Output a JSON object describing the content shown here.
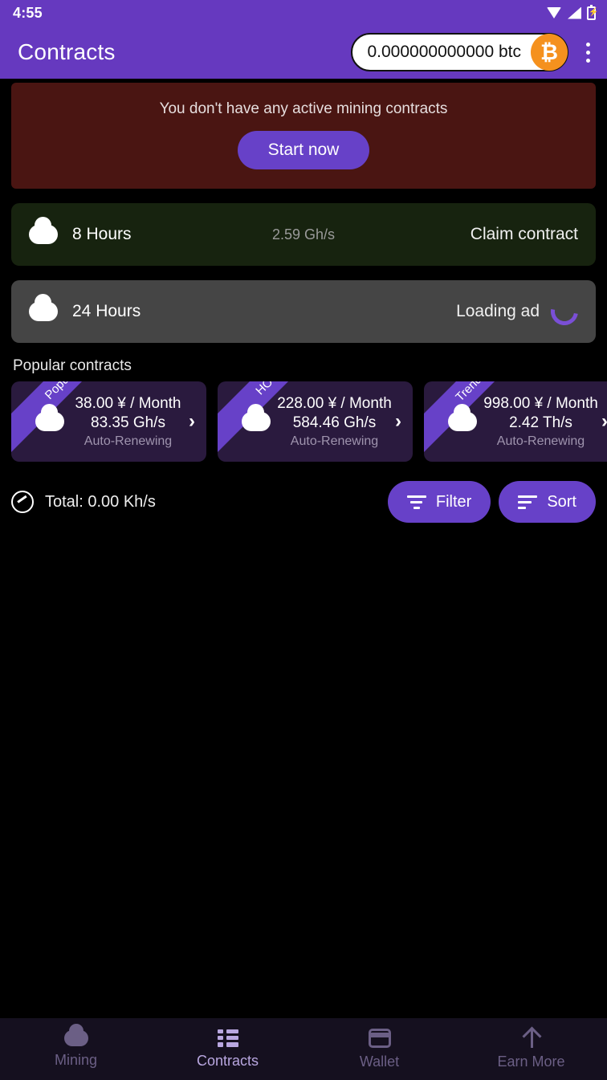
{
  "status_bar": {
    "time": "4:55",
    "icons": [
      "wifi-icon",
      "signal-icon",
      "battery-charging-icon"
    ]
  },
  "app_bar": {
    "title": "Contracts",
    "balance": "0.000000000000 btc",
    "currency_symbol": "₿",
    "overflow_label": "more-options",
    "accent_color": "#6639bf",
    "btc_color": "#f5911e"
  },
  "banner": {
    "message": "You don't have any active mining contracts",
    "cta_label": "Start now",
    "background_color": "#4a1512"
  },
  "claim_rows": [
    {
      "duration": "8 Hours",
      "rate": "2.59 Gh/s",
      "action": "Claim contract",
      "state": "ready",
      "background_color": "#17230f"
    },
    {
      "duration": "24 Hours",
      "rate": "",
      "action": "Loading ad",
      "state": "loading",
      "background_color": "#454545"
    }
  ],
  "popular": {
    "section_title": "Popular contracts",
    "cards": [
      {
        "ribbon": "Popular",
        "price": "38.00 ¥ / Month",
        "hashrate": "83.35 Gh/s",
        "renewal": "Auto-Renewing",
        "chevron": "›"
      },
      {
        "ribbon": "HOT!",
        "price": "228.00 ¥ / Month",
        "hashrate": "584.46 Gh/s",
        "renewal": "Auto-Renewing",
        "chevron": "›"
      },
      {
        "ribbon": "Trending",
        "price": "998.00 ¥ / Month",
        "hashrate": "2.42 Th/s",
        "renewal": "Auto-Renewing",
        "chevron": "›"
      }
    ]
  },
  "total_bar": {
    "total": "Total: 0.00 Kh/s",
    "filter_label": "Filter",
    "sort_label": "Sort"
  },
  "bottom_nav": {
    "items": [
      {
        "label": "Mining",
        "icon": "cloud-icon",
        "active": false
      },
      {
        "label": "Contracts",
        "icon": "list-icon",
        "active": true
      },
      {
        "label": "Wallet",
        "icon": "wallet-icon",
        "active": false
      },
      {
        "label": "Earn More",
        "icon": "arrow-up-icon",
        "active": false
      }
    ]
  }
}
